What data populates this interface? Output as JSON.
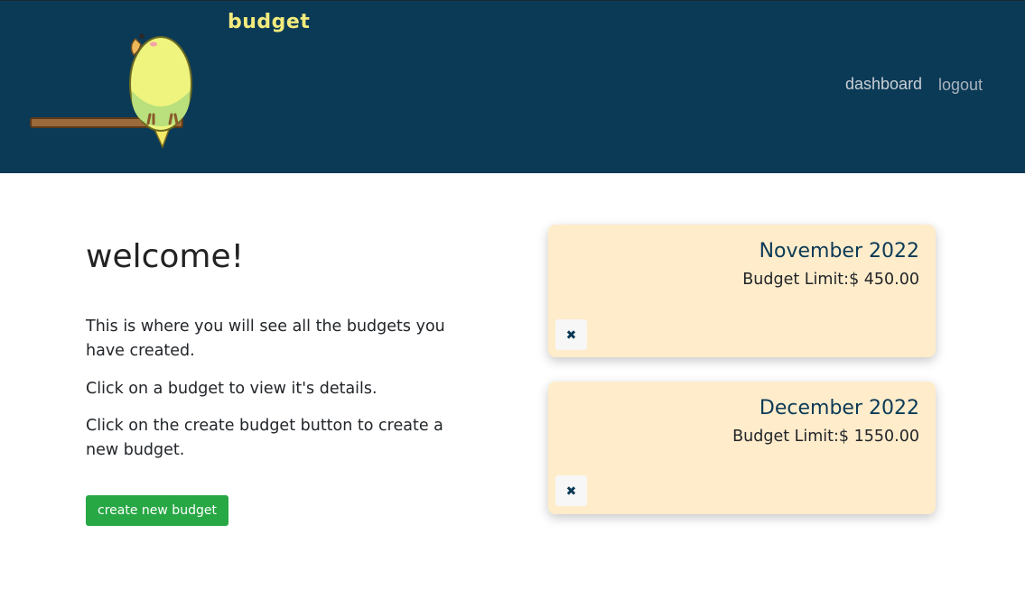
{
  "brand": {
    "title": "budget"
  },
  "nav": {
    "dashboard": "dashboard",
    "logout": "logout"
  },
  "main": {
    "heading": "welcome!",
    "paragraphs": [
      "This is where you will see all the budgets you have created.",
      "Click on a budget to view it's details.",
      "Click on the create budget button to create a new budget."
    ],
    "create_button": "create new budget"
  },
  "budgets": [
    {
      "title": "November 2022",
      "limit": "Budget Limit:$ 450.00",
      "delete_icon": "✖"
    },
    {
      "title": "December 2022",
      "limit": "Budget Limit:$ 1550.00",
      "delete_icon": "✖"
    }
  ],
  "colors": {
    "header_bg": "#0b3a56",
    "brand": "#f2ea7c",
    "card_bg": "#ffeccb",
    "create_button": "#28a745"
  }
}
